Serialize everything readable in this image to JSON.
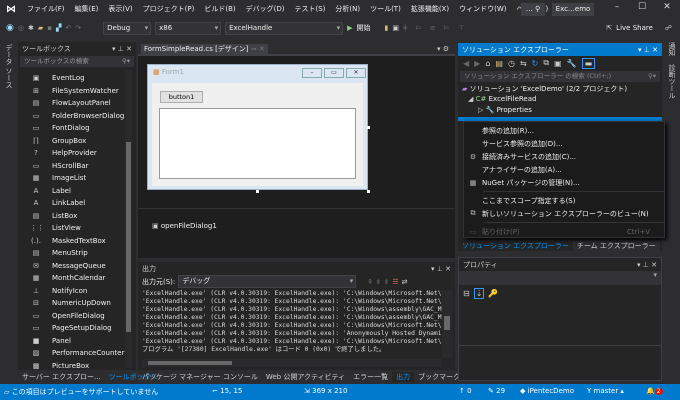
{
  "menu": {
    "items": [
      "ファイル(F)",
      "編集(E)",
      "表示(V)",
      "プロジェクト(P)",
      "ビルド(B)",
      "デバッグ(D)",
      "テスト(S)",
      "分析(N)",
      "ツール(T)",
      "拡張機能(X)",
      "ウィンドウ(W)",
      "ヘルプ(H)"
    ],
    "search": "…",
    "title": "Exc…emo"
  },
  "toolbar": {
    "config": "Debug",
    "platform": "x86",
    "startup": "ExcelHandle",
    "start_label": "開始",
    "live_share": "Live Share"
  },
  "left_strip": {
    "label": "データ ソース"
  },
  "toolbox": {
    "title": "ツールボックス",
    "search_placeholder": "ツールボックスの検索",
    "items": [
      {
        "label": "EventLog",
        "icon": "▣"
      },
      {
        "label": "FileSystemWatcher",
        "icon": "⊞"
      },
      {
        "label": "FlowLayoutPanel",
        "icon": "▤"
      },
      {
        "label": "FolderBrowserDialog",
        "icon": "▭"
      },
      {
        "label": "FontDialog",
        "icon": "▭"
      },
      {
        "label": "GroupBox",
        "icon": "⌈⌉"
      },
      {
        "label": "HelpProvider",
        "icon": "?"
      },
      {
        "label": "HScrollBar",
        "icon": "▭"
      },
      {
        "label": "ImageList",
        "icon": "▦"
      },
      {
        "label": "Label",
        "icon": "A"
      },
      {
        "label": "LinkLabel",
        "icon": "A"
      },
      {
        "label": "ListBox",
        "icon": "▤"
      },
      {
        "label": "ListView",
        "icon": "⋮⋮"
      },
      {
        "label": "MaskedTextBox",
        "icon": "(.)."
      },
      {
        "label": "MenuStrip",
        "icon": "▤"
      },
      {
        "label": "MessageQueue",
        "icon": "✉"
      },
      {
        "label": "MonthCalendar",
        "icon": "▦"
      },
      {
        "label": "NotifyIcon",
        "icon": "⊥"
      },
      {
        "label": "NumericUpDown",
        "icon": "⊟"
      },
      {
        "label": "OpenFileDialog",
        "icon": "▭"
      },
      {
        "label": "PageSetupDialog",
        "icon": "▭"
      },
      {
        "label": "Panel",
        "icon": "■"
      },
      {
        "label": "PerformanceCounter",
        "icon": "▨"
      },
      {
        "label": "PictureBox",
        "icon": "▩"
      }
    ]
  },
  "left_tabs": [
    "サーバー エクスプロー...",
    "ツールボックス"
  ],
  "editor": {
    "tab": "FormSimpleRead.cs [デザイン]",
    "form_title": "Form1",
    "button": "button1",
    "component": "openFileDialog1"
  },
  "output": {
    "title": "出力",
    "source_label": "出力元(S):",
    "source_value": "デバッグ",
    "lines": [
      "'ExcelHandle.exe' (CLR v4.0.30319: ExcelHandle.exe): 'C:\\Windows\\Microsoft.Net\\asse",
      "'ExcelHandle.exe' (CLR v4.0.30319: ExcelHandle.exe): 'C:\\Windows\\Microsoft.Net\\asse",
      "'ExcelHandle.exe' (CLR v4.0.30319: ExcelHandle.exe): 'C:\\Windows\\assembly\\GAC_MSIL\\",
      "'ExcelHandle.exe' (CLR v4.0.30319: ExcelHandle.exe): 'C:\\Windows\\assembly\\GAC_MSIL\\",
      "'ExcelHandle.exe' (CLR v4.0.30319: ExcelHandle.exe): 'C:\\Windows\\Microsoft.Net\\asse",
      "'ExcelHandle.exe' (CLR v4.0.30319: ExcelHandle.exe): 'Anonymously Hosted DynamicMet",
      "'ExcelHandle.exe' (CLR v4.0.30319: ExcelHandle.exe): 'C:\\Windows\\Microsoft.Net\\asse",
      "プログラム '[27380] ExcelHandle.exe' はコード 0 (0x0) で終了しました。"
    ]
  },
  "bottom_tabs": [
    "パッケージ マネージャー コンソール",
    "Web 公開アクティビティ",
    "エラー一覧",
    "出力",
    "ブックマーク"
  ],
  "solution": {
    "title": "ソリューション エクスプローラー",
    "search_placeholder": "ソリューション エクスプローラー の検索 (Ctrl+;)",
    "tree": [
      "ソリューション 'ExcelDemo' (2/2 プロジェクト)",
      "ExcelFileRead",
      "Properties"
    ],
    "tabs": [
      "ソリューション エクスプローラー",
      "チーム エクスプローラー"
    ]
  },
  "context_menu": {
    "items": [
      {
        "label": "参照の追加(R)...",
        "icon": ""
      },
      {
        "label": "サービス参照の追加(D)...",
        "icon": ""
      },
      {
        "label": "接続済みサービスの追加(C)...",
        "icon": "⚙"
      },
      {
        "label": "アナライザーの追加(A)...",
        "icon": ""
      },
      {
        "label": "NuGet パッケージの管理(N)...",
        "icon": "▦"
      }
    ],
    "items2": [
      {
        "label": "ここまでスコープ指定する(S)",
        "icon": ""
      },
      {
        "label": "新しいソリューション エクスプローラーのビュー(N)",
        "icon": "⧉"
      }
    ],
    "paste": {
      "label": "貼り付け(P)",
      "shortcut": "Ctrl+V"
    }
  },
  "properties": {
    "title": "プロパティ"
  },
  "right_strip": [
    "通知",
    "診断ツール"
  ],
  "status": {
    "message": "この項目はプレビューをサポートしていません",
    "position": "15, 15",
    "size": "369 x 210",
    "up": "0",
    "edits": "29",
    "repo": "iPentecDemo",
    "branch": "master",
    "notifications": "2"
  },
  "colors": {
    "accent": "#007acc",
    "background": "#2d2d30",
    "panel": "#252526"
  }
}
